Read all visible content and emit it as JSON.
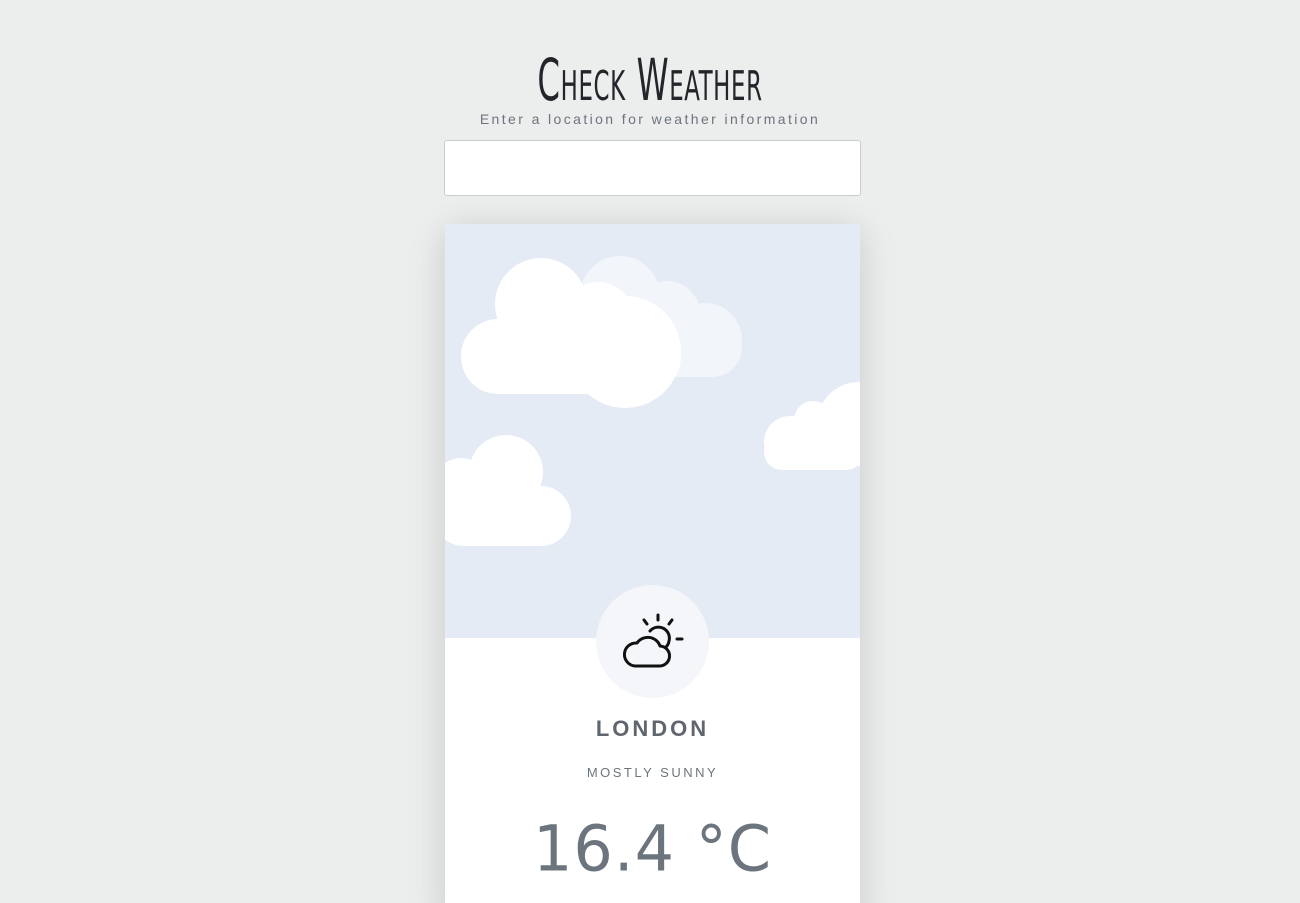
{
  "header": {
    "title": "Check Weather"
  },
  "search": {
    "label": "Enter a location for weather information",
    "value": "",
    "placeholder": ""
  },
  "weather": {
    "city": "LONDON",
    "condition": "MOSTLY SUNNY",
    "temperature": "16.4 °C",
    "icon": "partly-sunny-icon"
  },
  "colors": {
    "page_background": "#eceded",
    "sky_background": "#e4ebf5",
    "cloud": "#ffffff",
    "cloud_faded": "#f2f5fa",
    "text_muted": "#6c757d"
  }
}
